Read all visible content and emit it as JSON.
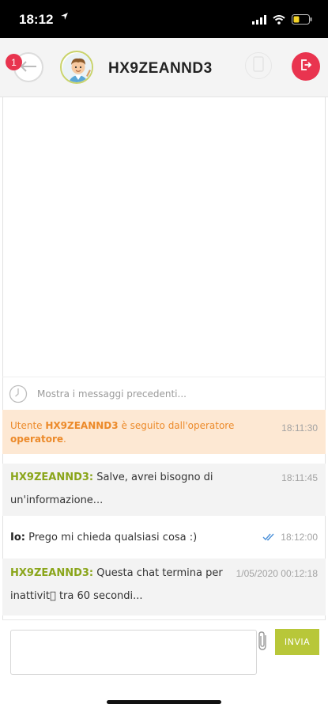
{
  "status_bar": {
    "time": "18:12",
    "icons": [
      "location-arrow-icon",
      "signal-icon",
      "wifi-icon",
      "battery-icon"
    ]
  },
  "header": {
    "badge_count": "1",
    "title": "HX9ZEANND3",
    "colors": {
      "exit": "#e9344f",
      "badge": "#e8344e",
      "avatar_ring": "#c9d36b"
    }
  },
  "chat": {
    "show_previous": "Mostra i messaggi precedenti...",
    "system_message": {
      "prefix": "Utente ",
      "user": "HX9ZEANND3",
      "middle": " è seguito dall'operatore",
      "operator": "operatore",
      "suffix": ".",
      "time": "18:11:30"
    },
    "messages": [
      {
        "sender": "HX9ZEANND3:",
        "line1": " Salve, avrei bisogno di",
        "line2": "un'informazione...",
        "time": "18:11:45"
      },
      {
        "sender": "Io:",
        "line1": " Prego mi chieda qualsiasi cosa :)",
        "time": "18:12:00"
      },
      {
        "sender": "HX9ZEANND3:",
        "line1": " Questa chat termina per",
        "line2": "inattivit\u0000 tra 60 secondi...",
        "time": "1/05/2020 00:12:18"
      }
    ]
  },
  "composer": {
    "input_value": "",
    "send_label": "INVIA",
    "colors": {
      "send": "#b8c739"
    }
  }
}
